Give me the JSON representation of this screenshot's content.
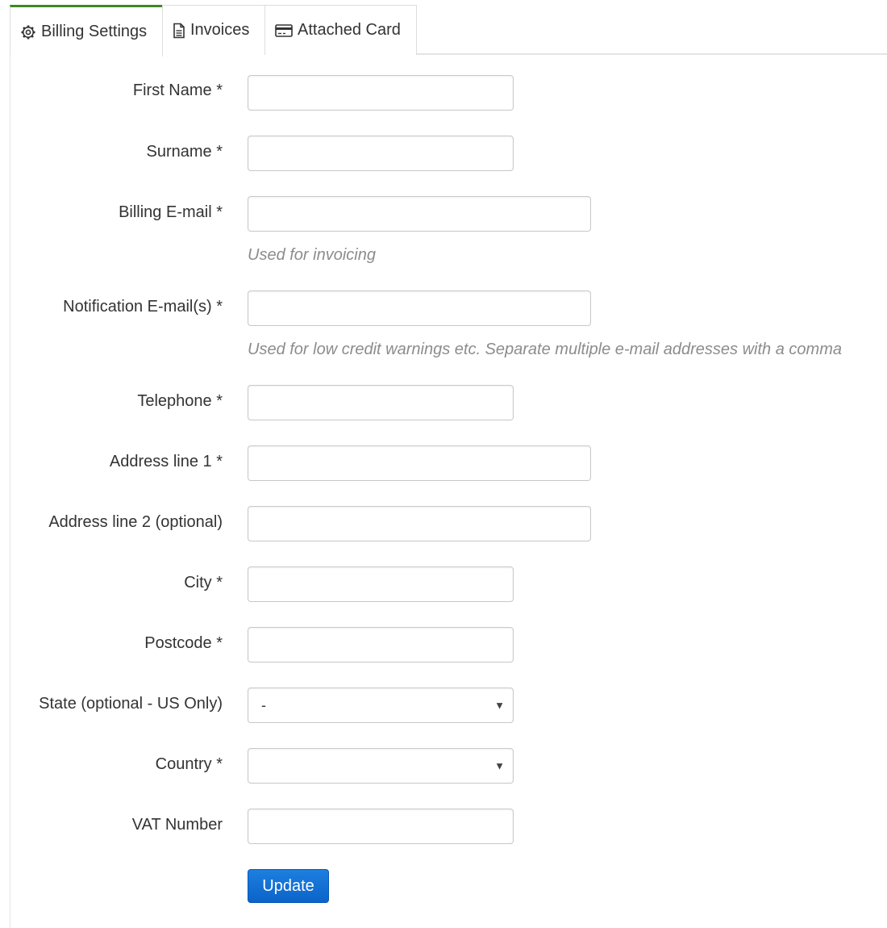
{
  "tabs": {
    "billing_settings": "Billing Settings",
    "invoices": "Invoices",
    "attached_card": "Attached Card"
  },
  "form": {
    "first_name": {
      "label": "First Name *",
      "value": ""
    },
    "surname": {
      "label": "Surname *",
      "value": ""
    },
    "billing_email": {
      "label": "Billing E-mail *",
      "value": "",
      "help": "Used for invoicing"
    },
    "notification_emails": {
      "label": "Notification E-mail(s) *",
      "value": "",
      "help": "Used for low credit warnings etc. Separate multiple e-mail addresses with a comma"
    },
    "telephone": {
      "label": "Telephone *",
      "value": ""
    },
    "address_line_1": {
      "label": "Address line 1 *",
      "value": ""
    },
    "address_line_2": {
      "label": "Address line 2 (optional)",
      "value": ""
    },
    "city": {
      "label": "City *",
      "value": ""
    },
    "postcode": {
      "label": "Postcode *",
      "value": ""
    },
    "state": {
      "label": "State (optional - US Only)",
      "selected": "-"
    },
    "country": {
      "label": "Country *",
      "selected": ""
    },
    "vat_number": {
      "label": "VAT Number",
      "value": ""
    }
  },
  "buttons": {
    "update": "Update"
  },
  "colors": {
    "active_tab_accent": "#3a8a26",
    "primary_button": "#0b63c9",
    "help_text": "#8c8c8c"
  }
}
